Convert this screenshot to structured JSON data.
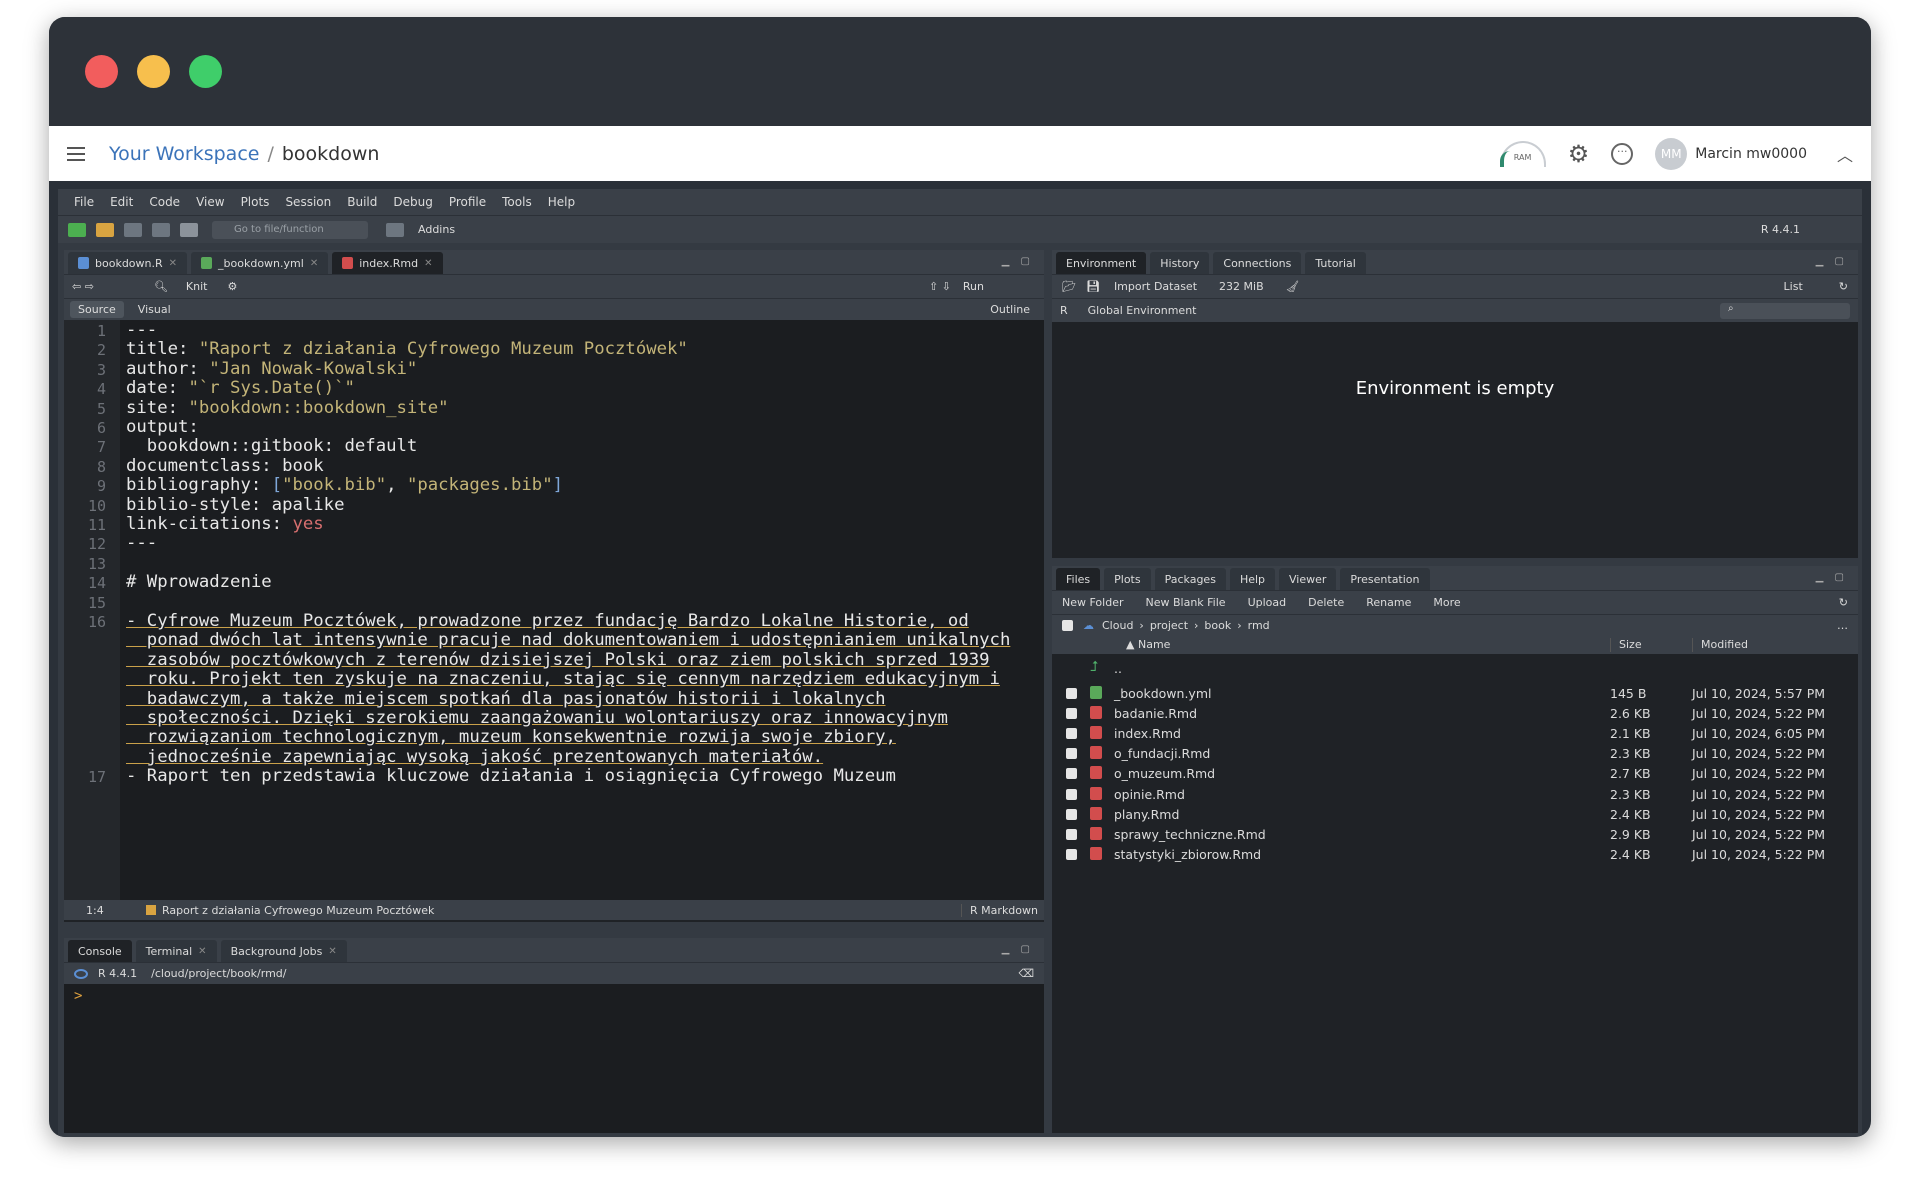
{
  "workspace": {
    "link": "Your Workspace",
    "separator": "/",
    "project": "bookdown",
    "ram_label": "RAM",
    "user_initials": "MM",
    "user_name": "Marcin mw0000"
  },
  "menu": [
    "File",
    "Edit",
    "Code",
    "View",
    "Plots",
    "Session",
    "Build",
    "Debug",
    "Profile",
    "Tools",
    "Help"
  ],
  "toolbar": {
    "goto_placeholder": "Go to file/function",
    "addins": "Addins",
    "r_version": "R 4.4.1"
  },
  "editor": {
    "tabs": [
      "bookdown.R",
      "_bookdown.yml",
      "index.Rmd"
    ],
    "knit": "Knit",
    "run": "Run",
    "modes": [
      "Source",
      "Visual"
    ],
    "outline": "Outline",
    "status_pos": "1:4",
    "status_chunk": "Raport z działania Cyfrowego Muzeum Pocztówek",
    "status_type": "R Markdown",
    "line_numbers": [
      "1",
      "2",
      "3",
      "4",
      "5",
      "6",
      "7",
      "8",
      "9",
      "10",
      "11",
      "12",
      "13",
      "14",
      "15",
      "16",
      "17"
    ]
  },
  "console": {
    "tabs": [
      "Console",
      "Terminal",
      "Background Jobs"
    ],
    "r_version": "R 4.4.1",
    "path": "/cloud/project/book/rmd/",
    "prompt": ">"
  },
  "environment": {
    "tabs": [
      "Environment",
      "History",
      "Connections",
      "Tutorial"
    ],
    "import_dataset": "Import Dataset",
    "memory": "232 MiB",
    "list": "List",
    "lang": "R",
    "scope": "Global Environment",
    "empty": "Environment is empty"
  },
  "files": {
    "tabs": [
      "Files",
      "Plots",
      "Packages",
      "Help",
      "Viewer",
      "Presentation"
    ],
    "actions": [
      "New Folder",
      "New Blank File",
      "Upload",
      "Delete",
      "Rename",
      "More"
    ],
    "breadcrumb": [
      "Cloud",
      "project",
      "book",
      "rmd"
    ],
    "columns": [
      "Name",
      "Size",
      "Modified"
    ],
    "parent": "..",
    "rows": [
      {
        "name": "_bookdown.yml",
        "size": "145 B",
        "modified": "Jul 10, 2024, 5:57 PM",
        "kind": "yml"
      },
      {
        "name": "badanie.Rmd",
        "size": "2.6 KB",
        "modified": "Jul 10, 2024, 5:22 PM",
        "kind": "rmd"
      },
      {
        "name": "index.Rmd",
        "size": "2.1 KB",
        "modified": "Jul 10, 2024, 6:05 PM",
        "kind": "rmd"
      },
      {
        "name": "o_fundacji.Rmd",
        "size": "2.3 KB",
        "modified": "Jul 10, 2024, 5:22 PM",
        "kind": "rmd"
      },
      {
        "name": "o_muzeum.Rmd",
        "size": "2.7 KB",
        "modified": "Jul 10, 2024, 5:22 PM",
        "kind": "rmd"
      },
      {
        "name": "opinie.Rmd",
        "size": "2.3 KB",
        "modified": "Jul 10, 2024, 5:22 PM",
        "kind": "rmd"
      },
      {
        "name": "plany.Rmd",
        "size": "2.4 KB",
        "modified": "Jul 10, 2024, 5:22 PM",
        "kind": "rmd"
      },
      {
        "name": "sprawy_techniczne.Rmd",
        "size": "2.9 KB",
        "modified": "Jul 10, 2024, 5:22 PM",
        "kind": "rmd"
      },
      {
        "name": "statystyki_zbiorow.Rmd",
        "size": "2.4 KB",
        "modified": "Jul 10, 2024, 5:22 PM",
        "kind": "rmd"
      }
    ]
  },
  "code_lines": {
    "l1": "---",
    "l2_key": "title: ",
    "l2_val": "\"Raport z działania Cyfrowego Muzeum Pocztówek\"",
    "l3_key": "author: ",
    "l3_val": "\"Jan Nowak-Kowalski\"",
    "l4_key": "date: ",
    "l4_val": "\"`r Sys.Date()`\"",
    "l5_key": "site: ",
    "l5_val": "\"bookdown::bookdown_site\"",
    "l6": "output:",
    "l7": "  bookdown::gitbook: default",
    "l8": "documentclass: book",
    "l9_key": "bibliography: ",
    "l9_open": "[",
    "l9_a": "\"book.bib\"",
    "l9_comma": ", ",
    "l9_b": "\"packages.bib\"",
    "l9_close": "]",
    "l10": "biblio-style: apalike",
    "l11_key": "link-citations: ",
    "l11_val": "yes",
    "l12": "---",
    "l14": "# Wprowadzenie",
    "l16a": "- Cyfrowe Muzeum Pocztówek, prowadzone przez fundację Bardzo Lokalne Historie, od",
    "l16b": "  ponad dwóch lat intensywnie pracuje nad dokumentowaniem i udostępnianiem unikalnych",
    "l16c": "  zasobów pocztówkowych z terenów dzisiejszej Polski oraz ziem polskich sprzed 1939",
    "l16d": "  roku. Projekt ten zyskuje na znaczeniu, stając się cennym narzędziem edukacyjnym i",
    "l16e": "  badawczym, a także miejscem spotkań dla pasjonatów historii i lokalnych",
    "l16f": "  społeczności. Dzięki szerokiemu zaangażowaniu wolontariuszy oraz innowacyjnym",
    "l16g": "  rozwiązaniom technologicznym, muzeum konsekwentnie rozwija swoje zbiory,",
    "l16h": "  jednocześnie zapewniając wysoką jakość prezentowanych materiałów.",
    "l17": "- Raport ten przedstawia kluczowe działania i osiągnięcia Cyfrowego Muzeum"
  },
  "colors": {
    "string": "#c3b478",
    "keyword": "#d76f6f",
    "link": "#3b73b9"
  }
}
